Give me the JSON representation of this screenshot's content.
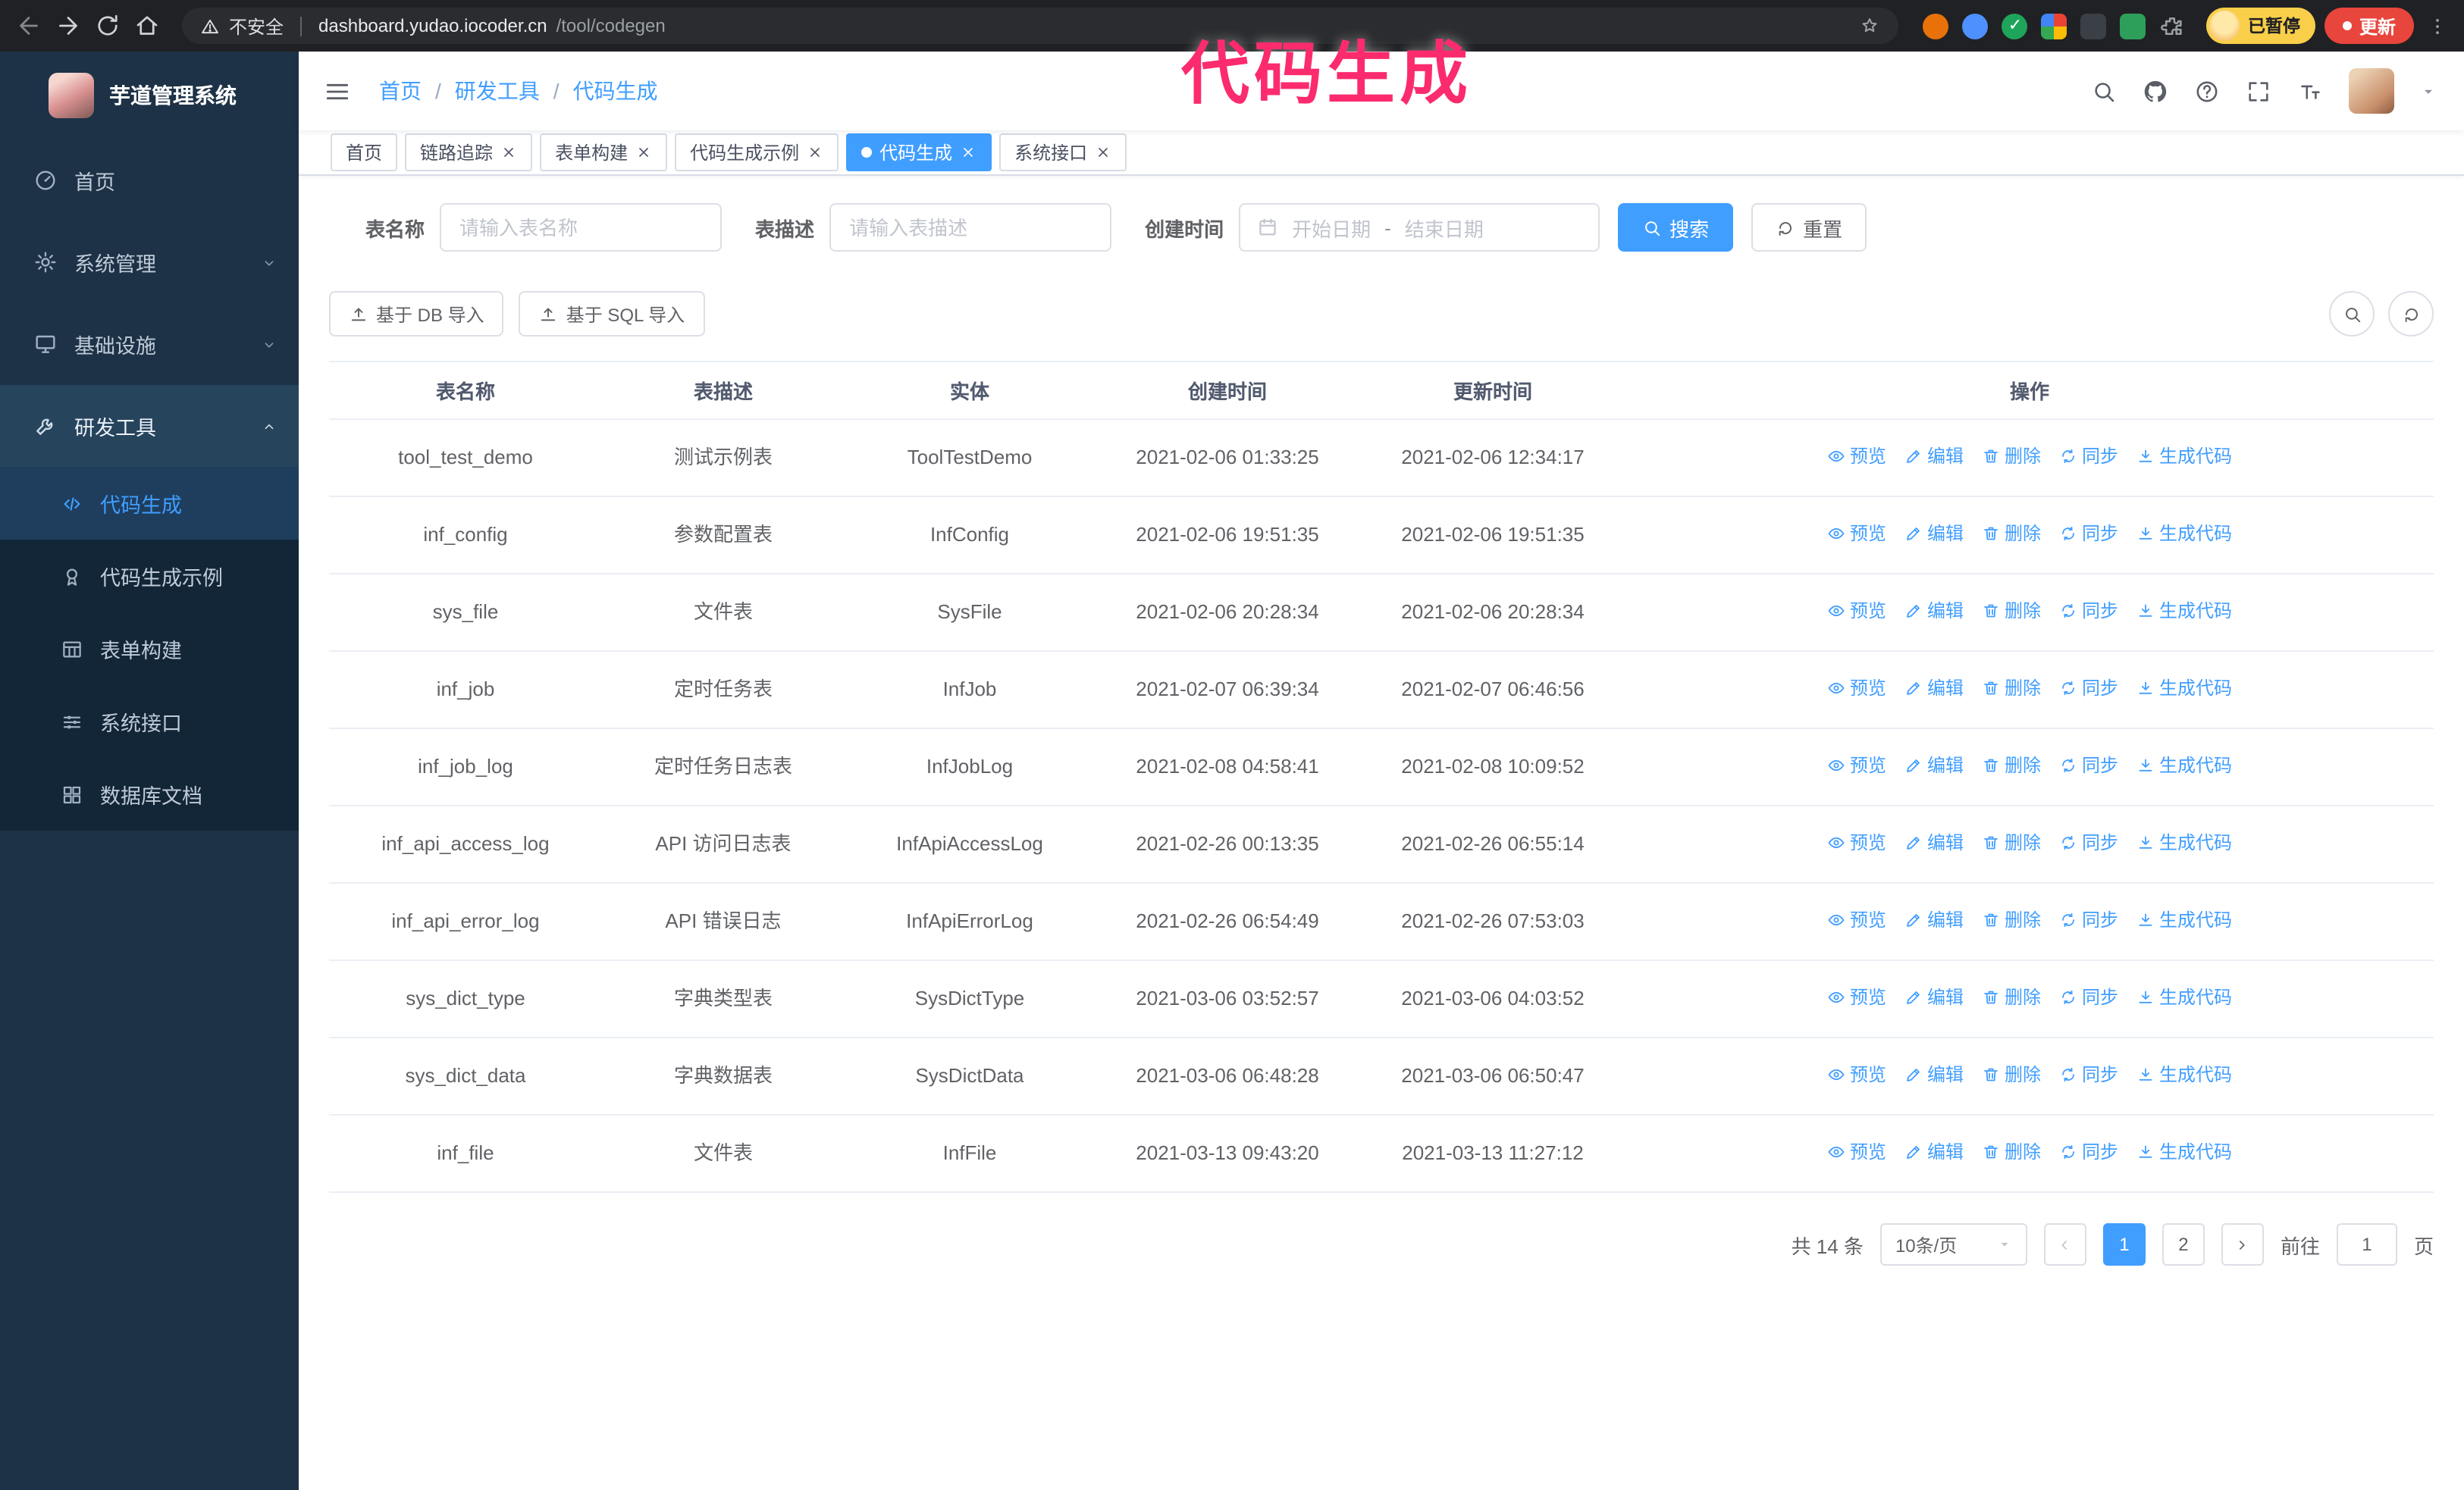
{
  "browser": {
    "security_label": "不安全",
    "url_host": "dashboard.yudao.iocoder.cn",
    "url_path": "/tool/codegen",
    "profile_badge": "已暂停",
    "update_label": "更新",
    "toolbar_icons": [
      "back-icon",
      "forward-icon",
      "reload-icon",
      "home-icon"
    ],
    "extensions": [
      {
        "name": "extension-icon-orange",
        "color": "#e8710a",
        "shape": "circle"
      },
      {
        "name": "extension-icon-blue",
        "color": "#4d90fe",
        "shape": "circle"
      },
      {
        "name": "extension-icon-green-check",
        "color": "#1ea55b",
        "shape": "circle",
        "check": true
      },
      {
        "name": "extension-grid-icon",
        "color": "#4285f4",
        "shape": "grid"
      },
      {
        "name": "extension-icon-dark",
        "color": "#3b3f46",
        "shape": "square"
      },
      {
        "name": "extension-icon-leaf",
        "color": "#2e9e5b",
        "shape": "square"
      },
      {
        "name": "puzzle-icon",
        "color": "#9aa0a6",
        "shape": "puzzle"
      }
    ]
  },
  "annotation": "代码生成",
  "sidebar": {
    "logo_title": "芋道管理系统",
    "menu": [
      {
        "key": "home",
        "label": "首页",
        "icon": "gauge-icon"
      },
      {
        "key": "system",
        "label": "系统管理",
        "icon": "gear-icon",
        "chevron": "down"
      },
      {
        "key": "infra",
        "label": "基础设施",
        "icon": "monitor-icon",
        "chevron": "down"
      },
      {
        "key": "devtools",
        "label": "研发工具",
        "icon": "wrench-icon",
        "chevron": "up",
        "open": true,
        "children": [
          {
            "key": "codegen",
            "label": "代码生成",
            "icon": "code-icon",
            "active": true
          },
          {
            "key": "codegen-example",
            "label": "代码生成示例",
            "icon": "medal-icon"
          },
          {
            "key": "form-builder",
            "label": "表单构建",
            "icon": "table-icon"
          },
          {
            "key": "api",
            "label": "系统接口",
            "icon": "sliders-icon"
          },
          {
            "key": "db-doc",
            "label": "数据库文档",
            "icon": "grid-icon"
          }
        ]
      }
    ]
  },
  "navbar": {
    "breadcrumb": [
      "首页",
      "研发工具",
      "代码生成"
    ],
    "icons": [
      "search-icon",
      "github-icon",
      "question-icon",
      "expand-icon",
      "fontsize-icon"
    ]
  },
  "tabs": [
    {
      "key": "home",
      "label": "首页",
      "closable": false,
      "active": false
    },
    {
      "key": "tracer",
      "label": "链路追踪",
      "closable": true,
      "active": false
    },
    {
      "key": "form-builder",
      "label": "表单构建",
      "closable": true,
      "active": false
    },
    {
      "key": "codegen-example",
      "label": "代码生成示例",
      "closable": true,
      "active": false
    },
    {
      "key": "codegen",
      "label": "代码生成",
      "closable": true,
      "active": true
    },
    {
      "key": "api",
      "label": "系统接口",
      "closable": true,
      "active": false
    }
  ],
  "filters": {
    "table_name_label": "表名称",
    "table_name_placeholder": "请输入表名称",
    "table_desc_label": "表描述",
    "table_desc_placeholder": "请输入表描述",
    "create_time_label": "创建时间",
    "date_start_placeholder": "开始日期",
    "date_separator": "-",
    "date_end_placeholder": "结束日期",
    "search_label": "搜索",
    "reset_label": "重置"
  },
  "toolbar": {
    "import_db": "基于 DB 导入",
    "import_sql": "基于 SQL 导入"
  },
  "table": {
    "columns": [
      "表名称",
      "表描述",
      "实体",
      "创建时间",
      "更新时间",
      "操作"
    ],
    "actions": [
      {
        "key": "preview",
        "label": "预览",
        "icon": "eye-icon"
      },
      {
        "key": "edit",
        "label": "编辑",
        "icon": "edit-icon"
      },
      {
        "key": "delete",
        "label": "删除",
        "icon": "delete-icon"
      },
      {
        "key": "sync",
        "label": "同步",
        "icon": "sync-icon"
      },
      {
        "key": "generate-code",
        "label": "生成代码",
        "icon": "download-icon"
      }
    ],
    "rows": [
      {
        "name": "tool_test_demo",
        "desc": "测试示例表",
        "entity": "ToolTestDemo",
        "created": "2021-02-06 01:33:25",
        "updated": "2021-02-06 12:34:17"
      },
      {
        "name": "inf_config",
        "desc": "参数配置表",
        "entity": "InfConfig",
        "created": "2021-02-06 19:51:35",
        "updated": "2021-02-06 19:51:35"
      },
      {
        "name": "sys_file",
        "desc": "文件表",
        "entity": "SysFile",
        "created": "2021-02-06 20:28:34",
        "updated": "2021-02-06 20:28:34"
      },
      {
        "name": "inf_job",
        "desc": "定时任务表",
        "entity": "InfJob",
        "created": "2021-02-07 06:39:34",
        "updated": "2021-02-07 06:46:56"
      },
      {
        "name": "inf_job_log",
        "desc": "定时任务日志表",
        "entity": "InfJobLog",
        "created": "2021-02-08 04:58:41",
        "updated": "2021-02-08 10:09:52"
      },
      {
        "name": "inf_api_access_log",
        "desc": "API 访问日志表",
        "entity": "InfApiAccessLog",
        "created": "2021-02-26 00:13:35",
        "updated": "2021-02-26 06:55:14"
      },
      {
        "name": "inf_api_error_log",
        "desc": "API 错误日志",
        "entity": "InfApiErrorLog",
        "created": "2021-02-26 06:54:49",
        "updated": "2021-02-26 07:53:03"
      },
      {
        "name": "sys_dict_type",
        "desc": "字典类型表",
        "entity": "SysDictType",
        "created": "2021-03-06 03:52:57",
        "updated": "2021-03-06 04:03:52"
      },
      {
        "name": "sys_dict_data",
        "desc": "字典数据表",
        "entity": "SysDictData",
        "created": "2021-03-06 06:48:28",
        "updated": "2021-03-06 06:50:47"
      },
      {
        "name": "inf_file",
        "desc": "文件表",
        "entity": "InfFile",
        "created": "2021-03-13 09:43:20",
        "updated": "2021-03-13 11:27:12"
      }
    ]
  },
  "pagination": {
    "total": "共 14 条",
    "page_size": "10条/页",
    "pages": [
      "1",
      "2"
    ],
    "active_page": "1",
    "goto_label": "前往",
    "goto_value": "1",
    "goto_suffix": "页"
  },
  "colors": {
    "accent": "#409eff",
    "annotation": "#fb2b6e",
    "update_button": "#e8453c",
    "profile_badge": "#f9cf4a",
    "chrome_bg": "#202124",
    "sidebar_bg": "#1d3246"
  }
}
